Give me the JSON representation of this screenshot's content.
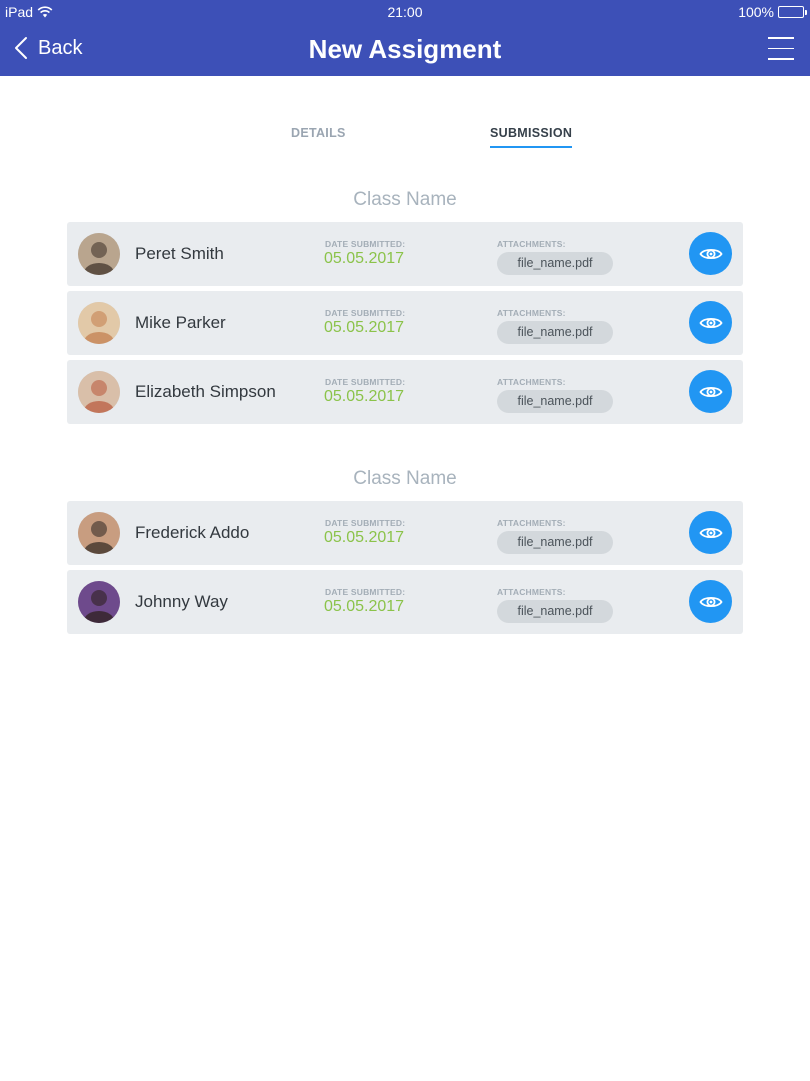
{
  "status_bar": {
    "device": "iPad",
    "time": "21:00",
    "battery": "100%"
  },
  "header": {
    "back_label": "Back",
    "title": "New Assigment"
  },
  "tabs": [
    {
      "label": "DETAILS",
      "active": false
    },
    {
      "label": "SUBMISSION",
      "active": true
    }
  ],
  "labels": {
    "date_submitted": "DATE SUBMITTED:",
    "attachments": "ATTACHMENTS:"
  },
  "colors": {
    "header": "#3d50b7",
    "accent": "#2196f3",
    "date": "#8bc34a"
  },
  "groups": [
    {
      "title": "Class Name",
      "students": [
        {
          "name": "Peret Smith",
          "date": "05.05.2017",
          "file": "file_name.pdf"
        },
        {
          "name": "Mike Parker",
          "date": "05.05.2017",
          "file": "file_name.pdf"
        },
        {
          "name": "Elizabeth Simpson",
          "date": "05.05.2017",
          "file": "file_name.pdf"
        }
      ]
    },
    {
      "title": "Class Name",
      "students": [
        {
          "name": "Frederick Addo",
          "date": "05.05.2017",
          "file": "file_name.pdf"
        },
        {
          "name": "Johnny Way",
          "date": "05.05.2017",
          "file": "file_name.pdf"
        }
      ]
    }
  ]
}
